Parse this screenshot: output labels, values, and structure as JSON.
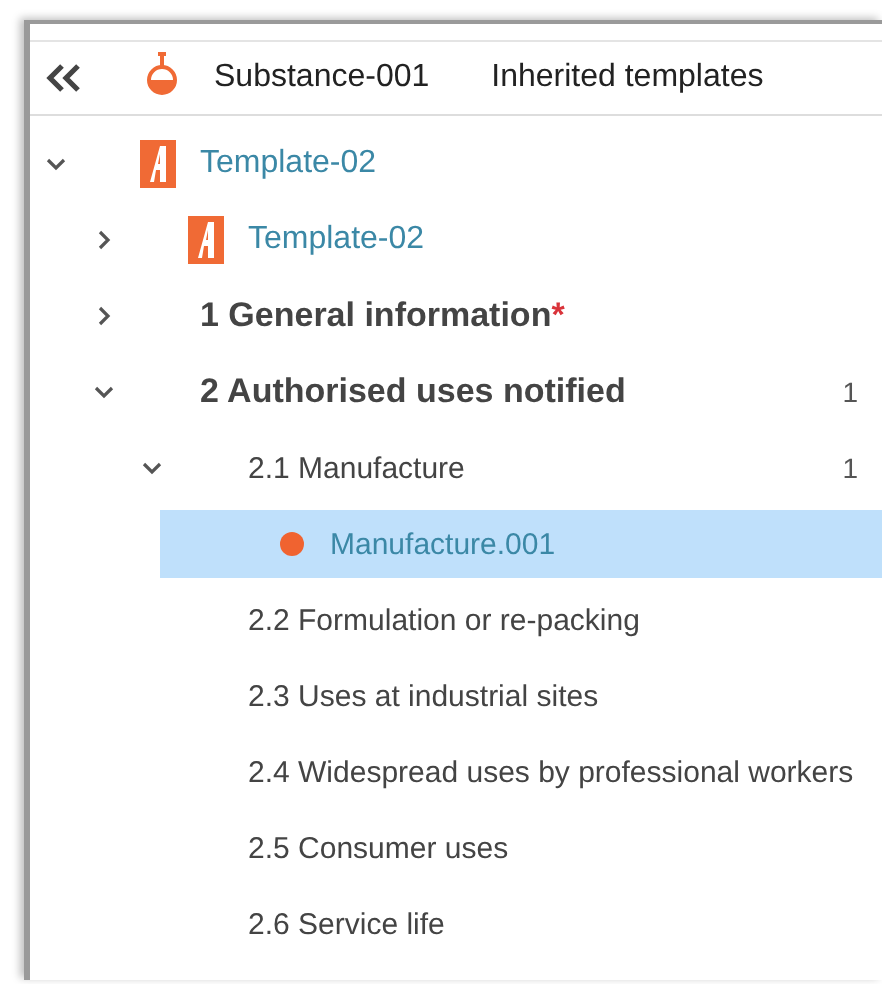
{
  "header": {
    "substance": "Substance-001",
    "tab": "Inherited templates"
  },
  "tree": [
    {
      "kind": "template",
      "label": "Template-02",
      "expanded": true,
      "selected": false,
      "children": [
        {
          "kind": "template",
          "label": "Template-02",
          "expanded": false,
          "selected": false
        },
        {
          "kind": "section",
          "label": "1 General information",
          "required_mark": "*",
          "expanded": false,
          "selected": false
        },
        {
          "kind": "section",
          "label": "2 Authorised uses notified",
          "count": "1",
          "expanded": true,
          "selected": false,
          "children": [
            {
              "kind": "plain",
              "label": "2.1 Manufacture",
              "count": "1",
              "expanded": true,
              "selected": false,
              "children": [
                {
                  "kind": "record",
                  "label": "Manufacture.001",
                  "selected": true
                }
              ]
            },
            {
              "kind": "plain",
              "label": "2.2 Formulation or re-packing",
              "selected": false
            },
            {
              "kind": "plain",
              "label": "2.3 Uses at industrial sites",
              "selected": false
            },
            {
              "kind": "plain",
              "label": "2.4 Widespread uses by professional workers",
              "selected": false
            },
            {
              "kind": "plain",
              "label": "2.5 Consumer uses",
              "selected": false
            },
            {
              "kind": "plain",
              "label": "2.6 Service life",
              "selected": false
            }
          ]
        }
      ]
    }
  ]
}
